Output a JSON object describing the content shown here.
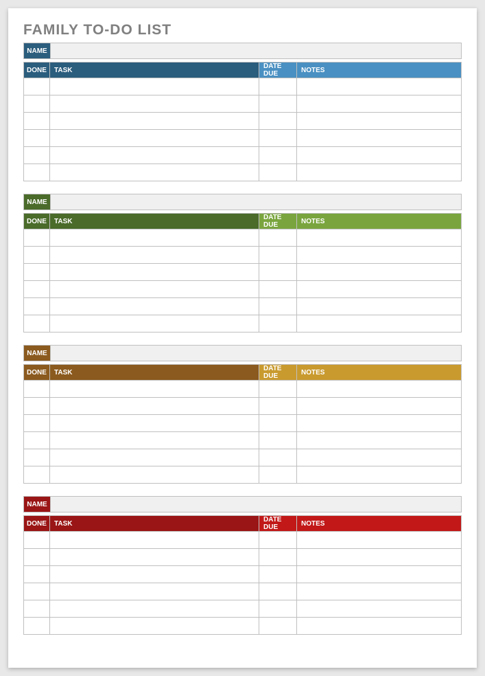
{
  "title": "FAMILY TO-DO LIST",
  "columns": {
    "name": "NAME",
    "done": "DONE",
    "task": "TASK",
    "due": "DATE DUE",
    "notes": "NOTES"
  },
  "sections": [
    {
      "dark": "#2b5d7d",
      "light": "#4a90c2",
      "rows": 6
    },
    {
      "dark": "#4a6b2a",
      "light": "#7aa53e",
      "rows": 6
    },
    {
      "dark": "#8b5a1e",
      "light": "#c99a2e",
      "rows": 6
    },
    {
      "dark": "#9a1515",
      "light": "#c21818",
      "rows": 6
    }
  ]
}
